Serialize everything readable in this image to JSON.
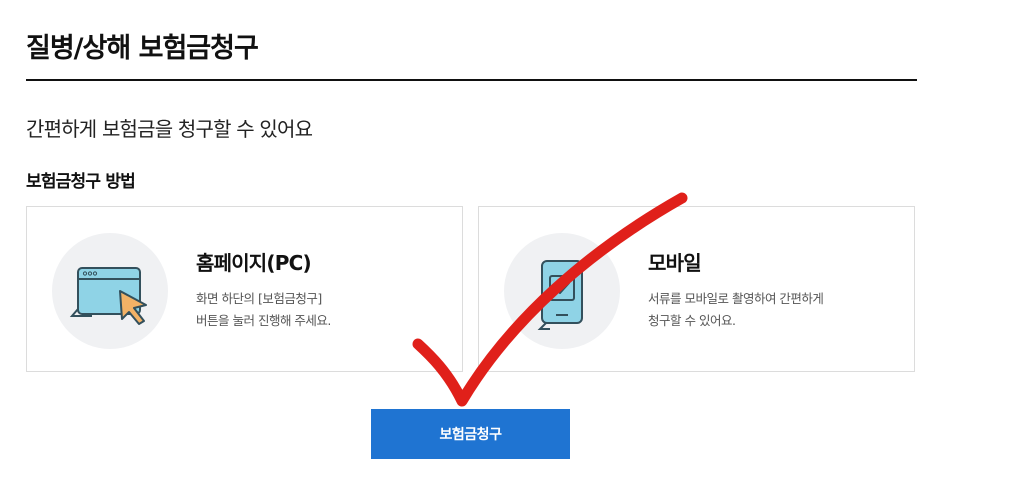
{
  "page": {
    "title": "질병/상해 보험금청구",
    "intro": "간편하게 보험금을 청구할 수 있어요",
    "section_title": "보험금청구 방법"
  },
  "methods": [
    {
      "title": "홈페이지(PC)",
      "desc_lines": [
        "화면 하단의 [보험금청구]",
        "버튼을 눌러 진행해 주세요."
      ],
      "icon": "browser-cursor-icon"
    },
    {
      "title": "모바일",
      "desc_lines": [
        "서류를 모바일로 촬영하여 간편하게",
        "청구할 수 있어요."
      ],
      "icon": "mobile-check-icon"
    }
  ],
  "claim_button_label": "보험금청구",
  "colors": {
    "accent": "#1f74d2",
    "icon_fill": "#8fd3e6",
    "icon_stroke": "#33505c",
    "cursor": "#f2b266",
    "annotation": "#e0201a"
  }
}
